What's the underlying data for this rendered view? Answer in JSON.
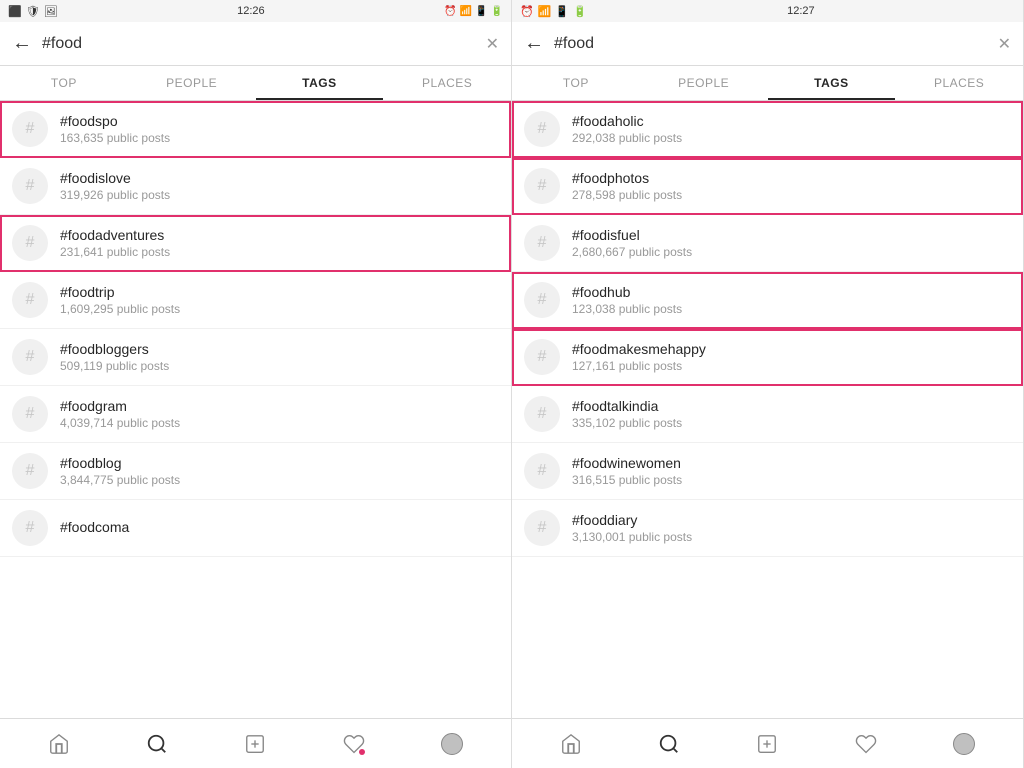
{
  "panel1": {
    "status": {
      "time": "12:26",
      "icons_left": [
        "sim",
        "shield",
        "image"
      ],
      "icons_right": [
        "alarm",
        "wifi",
        "signal",
        "battery"
      ]
    },
    "search_query": "#food",
    "tabs": [
      "TOP",
      "PEOPLE",
      "TAGS",
      "PLACES"
    ],
    "active_tab": "TAGS",
    "tags": [
      {
        "name": "#foodspo",
        "count": "163,635 public posts",
        "highlighted": true
      },
      {
        "name": "#foodislove",
        "count": "319,926 public posts",
        "highlighted": false
      },
      {
        "name": "#foodadventures",
        "count": "231,641 public posts",
        "highlighted": true
      },
      {
        "name": "#foodtrip",
        "count": "1,609,295 public posts",
        "highlighted": false
      },
      {
        "name": "#foodbloggers",
        "count": "509,119 public posts",
        "highlighted": false
      },
      {
        "name": "#foodgram",
        "count": "4,039,714 public posts",
        "highlighted": false
      },
      {
        "name": "#foodblog",
        "count": "3,844,775 public posts",
        "highlighted": false
      },
      {
        "name": "#foodcoma",
        "count": "",
        "highlighted": false
      }
    ],
    "nav": [
      "home",
      "search",
      "add",
      "heart",
      "profile"
    ]
  },
  "panel2": {
    "status": {
      "time": "12:27",
      "icons_left": [
        "alarm",
        "wifi",
        "signal",
        "battery"
      ],
      "icons_right": []
    },
    "search_query": "#food",
    "tabs": [
      "TOP",
      "PEOPLE",
      "TAGS",
      "PLACES"
    ],
    "active_tab": "TAGS",
    "tags": [
      {
        "name": "#foodaholic",
        "count": "292,038 public posts",
        "highlighted": true
      },
      {
        "name": "#foodphotos",
        "count": "278,598 public posts",
        "highlighted": true
      },
      {
        "name": "#foodisfuel",
        "count": "2,680,667 public posts",
        "highlighted": false
      },
      {
        "name": "#foodhub",
        "count": "123,038 public posts",
        "highlighted": true
      },
      {
        "name": "#foodmakesmehappy",
        "count": "127,161 public posts",
        "highlighted": true
      },
      {
        "name": "#foodtalkindia",
        "count": "335,102 public posts",
        "highlighted": false
      },
      {
        "name": "#foodwinewomen",
        "count": "316,515 public posts",
        "highlighted": false
      },
      {
        "name": "#fooddiary",
        "count": "3,130,001 public posts",
        "highlighted": false
      }
    ],
    "nav": [
      "home",
      "search",
      "add",
      "heart",
      "profile"
    ]
  }
}
